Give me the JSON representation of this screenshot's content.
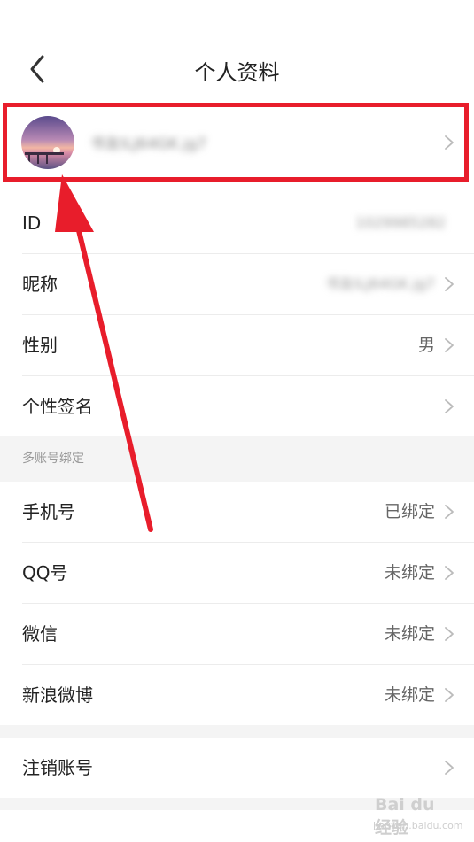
{
  "header": {
    "title": "个人资料"
  },
  "profile": {
    "name_blurred": "书友ILJ64GK.jg7"
  },
  "rows": {
    "id": {
      "label": "ID",
      "value": "1029985282"
    },
    "nickname": {
      "label": "昵称",
      "value": "书友ILJ64GK.jg7"
    },
    "gender": {
      "label": "性别",
      "value": "男"
    },
    "signature": {
      "label": "个性签名",
      "value": ""
    }
  },
  "section": {
    "multi_account": "多账号绑定"
  },
  "bindings": {
    "phone": {
      "label": "手机号",
      "value": "已绑定"
    },
    "qq": {
      "label": "QQ号",
      "value": "未绑定"
    },
    "wechat": {
      "label": "微信",
      "value": "未绑定"
    },
    "weibo": {
      "label": "新浪微博",
      "value": "未绑定"
    }
  },
  "logout": {
    "label": "注销账号"
  },
  "watermark": {
    "brand": "Bai du 经验",
    "url": "jingyan.baidu.com"
  },
  "colors": {
    "annotation_red": "#e81d2b",
    "section_bg": "#f4f4f4"
  }
}
